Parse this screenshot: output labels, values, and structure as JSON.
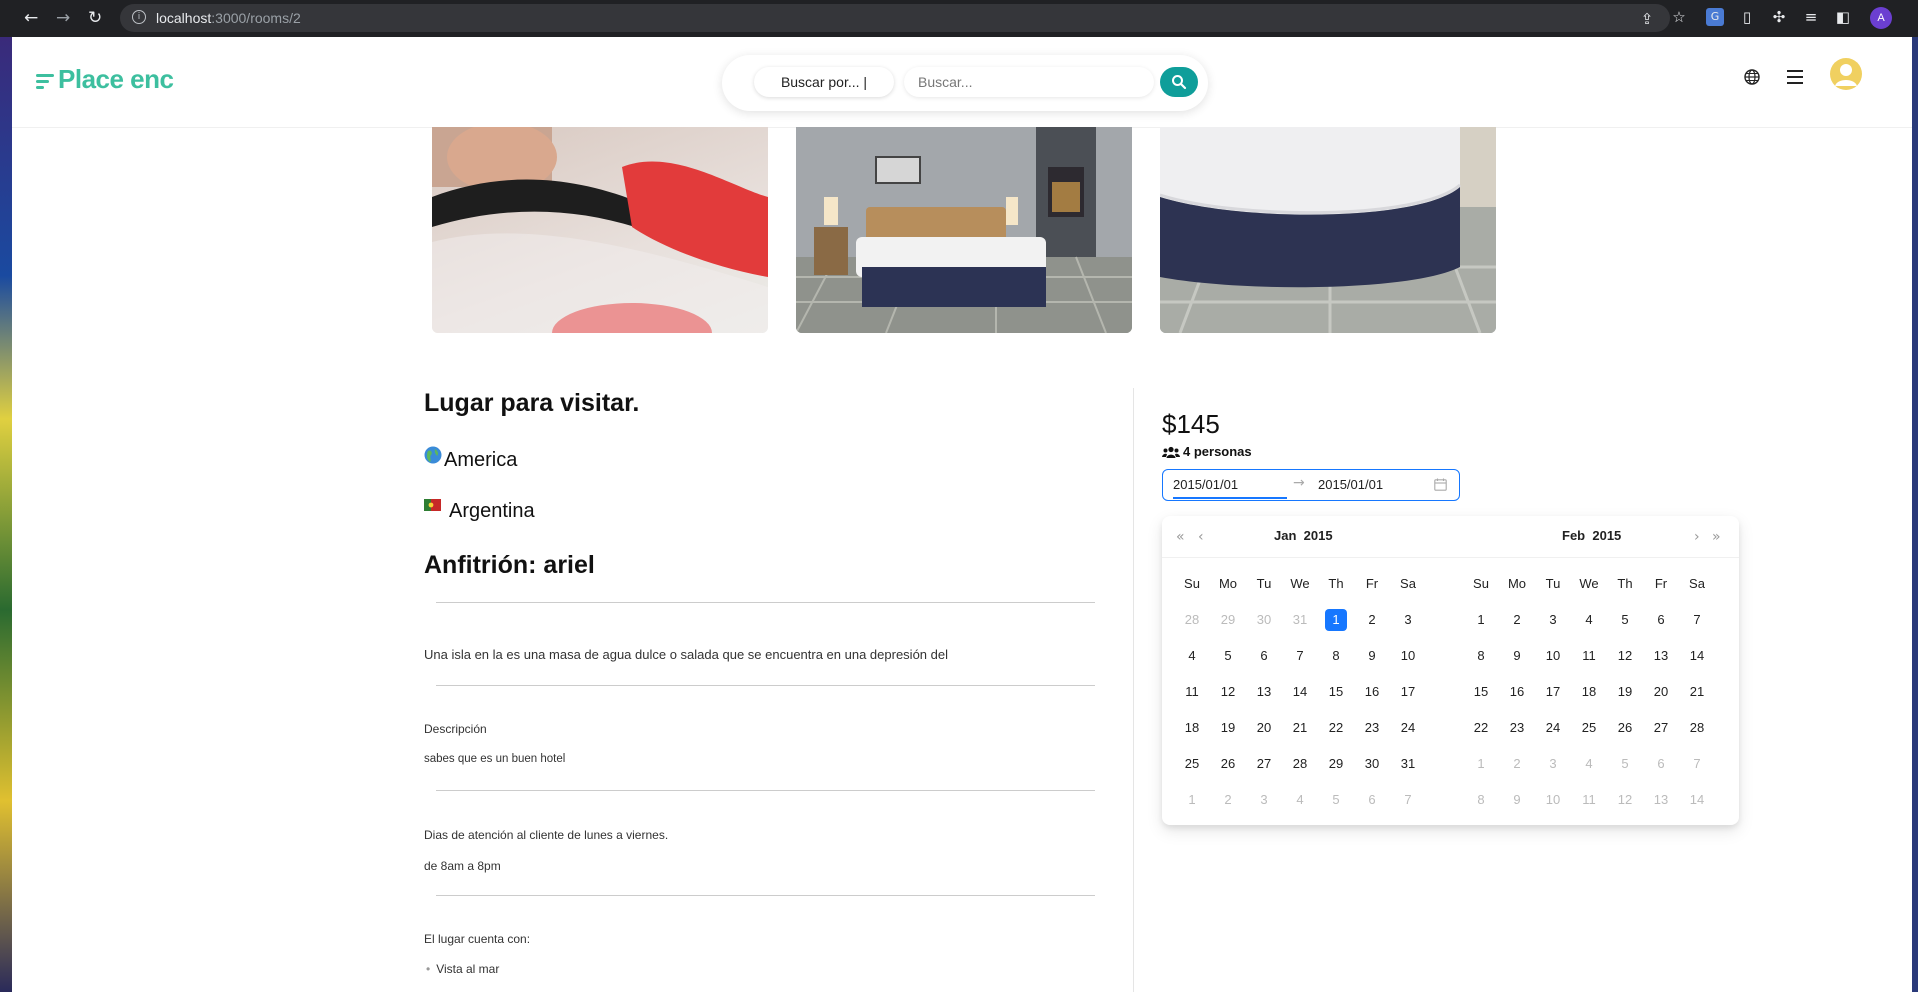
{
  "browser": {
    "url_host": "localhost",
    "url_path": ":3000/rooms/2",
    "profile_initial": "A"
  },
  "header": {
    "logo": "Place enc",
    "search_by_label": "Buscar por... |",
    "search_placeholder": "Buscar..."
  },
  "listing": {
    "title": "Lugar para visitar.",
    "continent": "America",
    "country": "Argentina",
    "host_label": "Anfitrión: ariel",
    "intro": "Una isla en la es una masa de agua dulce o salada que se encuentra en una depresión del",
    "description_label": "Descripción",
    "description": "sabes que es un buen hotel",
    "service_days": "Dias de atención al cliente de lunes a viernes.",
    "service_hours": "de 8am a 8pm",
    "amenities_label": "El lugar cuenta con:",
    "amenities": [
      "Vista al mar"
    ]
  },
  "booking": {
    "price": "$145",
    "persons": "4 personas",
    "start_date": "2015/01/01",
    "end_date": "2015/01/01"
  },
  "calendar": {
    "weekdays": [
      "Su",
      "Mo",
      "Tu",
      "We",
      "Th",
      "Fr",
      "Sa"
    ],
    "months": [
      {
        "month": "Jan",
        "year": "2015",
        "weeks": [
          [
            "28",
            "29",
            "30",
            "31",
            "1",
            "2",
            "3"
          ],
          [
            "4",
            "5",
            "6",
            "7",
            "8",
            "9",
            "10"
          ],
          [
            "11",
            "12",
            "13",
            "14",
            "15",
            "16",
            "17"
          ],
          [
            "18",
            "19",
            "20",
            "21",
            "22",
            "23",
            "24"
          ],
          [
            "25",
            "26",
            "27",
            "28",
            "29",
            "30",
            "31"
          ],
          [
            "1",
            "2",
            "3",
            "4",
            "5",
            "6",
            "7"
          ]
        ],
        "out_before": 4,
        "out_after": 7,
        "selected": "1"
      },
      {
        "month": "Feb",
        "year": "2015",
        "weeks": [
          [
            "1",
            "2",
            "3",
            "4",
            "5",
            "6",
            "7"
          ],
          [
            "8",
            "9",
            "10",
            "11",
            "12",
            "13",
            "14"
          ],
          [
            "15",
            "16",
            "17",
            "18",
            "19",
            "20",
            "21"
          ],
          [
            "22",
            "23",
            "24",
            "25",
            "26",
            "27",
            "28"
          ],
          [
            "1",
            "2",
            "3",
            "4",
            "5",
            "6",
            "7"
          ],
          [
            "8",
            "9",
            "10",
            "11",
            "12",
            "13",
            "14"
          ]
        ],
        "out_before": 0,
        "out_after": 14,
        "selected": null
      }
    ]
  },
  "colors": {
    "brand": "#3dbf9f",
    "search_button": "#0f9e9a",
    "accent": "#1677ff",
    "avatar": "#f0d060"
  }
}
